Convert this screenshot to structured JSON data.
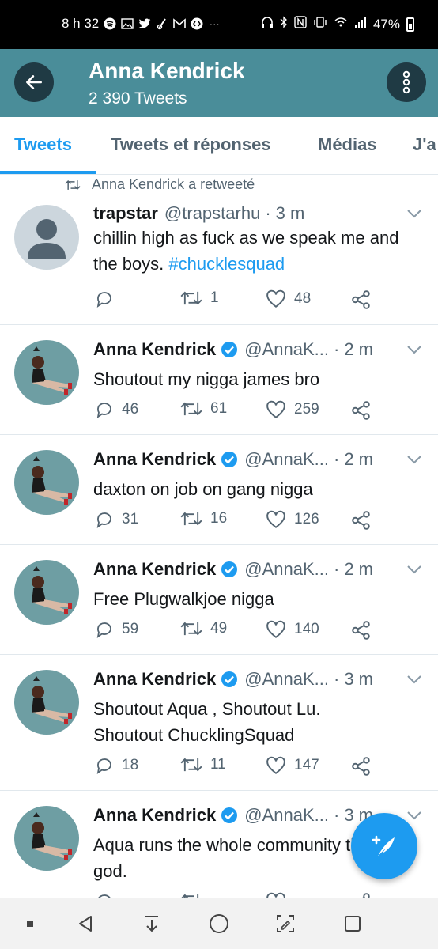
{
  "status_bar": {
    "time": "8 h 32",
    "dots": "···",
    "battery": "47%"
  },
  "header": {
    "title": "Anna Kendrick",
    "subtitle": "2 390 Tweets"
  },
  "tabs": [
    {
      "label": "Tweets"
    },
    {
      "label": "Tweets et réponses"
    },
    {
      "label": "Médias"
    },
    {
      "label": "J'a"
    }
  ],
  "tweets": [
    {
      "retweet_label": "Anna Kendrick a retweeté",
      "name": "trapstar",
      "handle": "@trapstarhu",
      "sep": "·",
      "time": "3 m",
      "text": "chillin high as fuck as we speak me and the boys. ",
      "hashtag": "#chucklesquad",
      "replies": "",
      "retweets": "1",
      "likes": "48"
    },
    {
      "name": "Anna Kendrick",
      "handle": "@AnnaK...",
      "sep": "·",
      "time": "2 m",
      "text": "Shoutout my nigga james bro",
      "replies": "46",
      "retweets": "61",
      "likes": "259"
    },
    {
      "name": "Anna Kendrick",
      "handle": "@AnnaK...",
      "sep": "·",
      "time": "2 m",
      "text": "daxton on job on gang nigga",
      "replies": "31",
      "retweets": "16",
      "likes": "126"
    },
    {
      "name": "Anna Kendrick",
      "handle": "@AnnaK...",
      "sep": "·",
      "time": "2 m",
      "text": "Free Plugwalkjoe nigga",
      "replies": "59",
      "retweets": "49",
      "likes": "140"
    },
    {
      "name": "Anna Kendrick",
      "handle": "@AnnaK...",
      "sep": "·",
      "time": "3 m",
      "text": "Shoutout Aqua , Shoutout Lu. Shoutout ChucklingSquad",
      "replies": "18",
      "retweets": "11",
      "likes": "147"
    },
    {
      "name": "Anna Kendrick",
      "handle": "@AnnaK...",
      "sep": "·",
      "time": "3 m",
      "text": "Aqua runs the whole community that's on god.",
      "replies": "",
      "retweets": "",
      "likes": ""
    }
  ],
  "colors": {
    "header_bg": "#4a8d99",
    "accent": "#1d9bf0",
    "muted": "#536471"
  },
  "icons": [
    "back-arrow-icon",
    "more-vertical-icon",
    "retweet-icon",
    "reply-icon",
    "like-icon",
    "share-icon",
    "chevron-down-icon",
    "verified-badge-icon",
    "compose-icon"
  ]
}
